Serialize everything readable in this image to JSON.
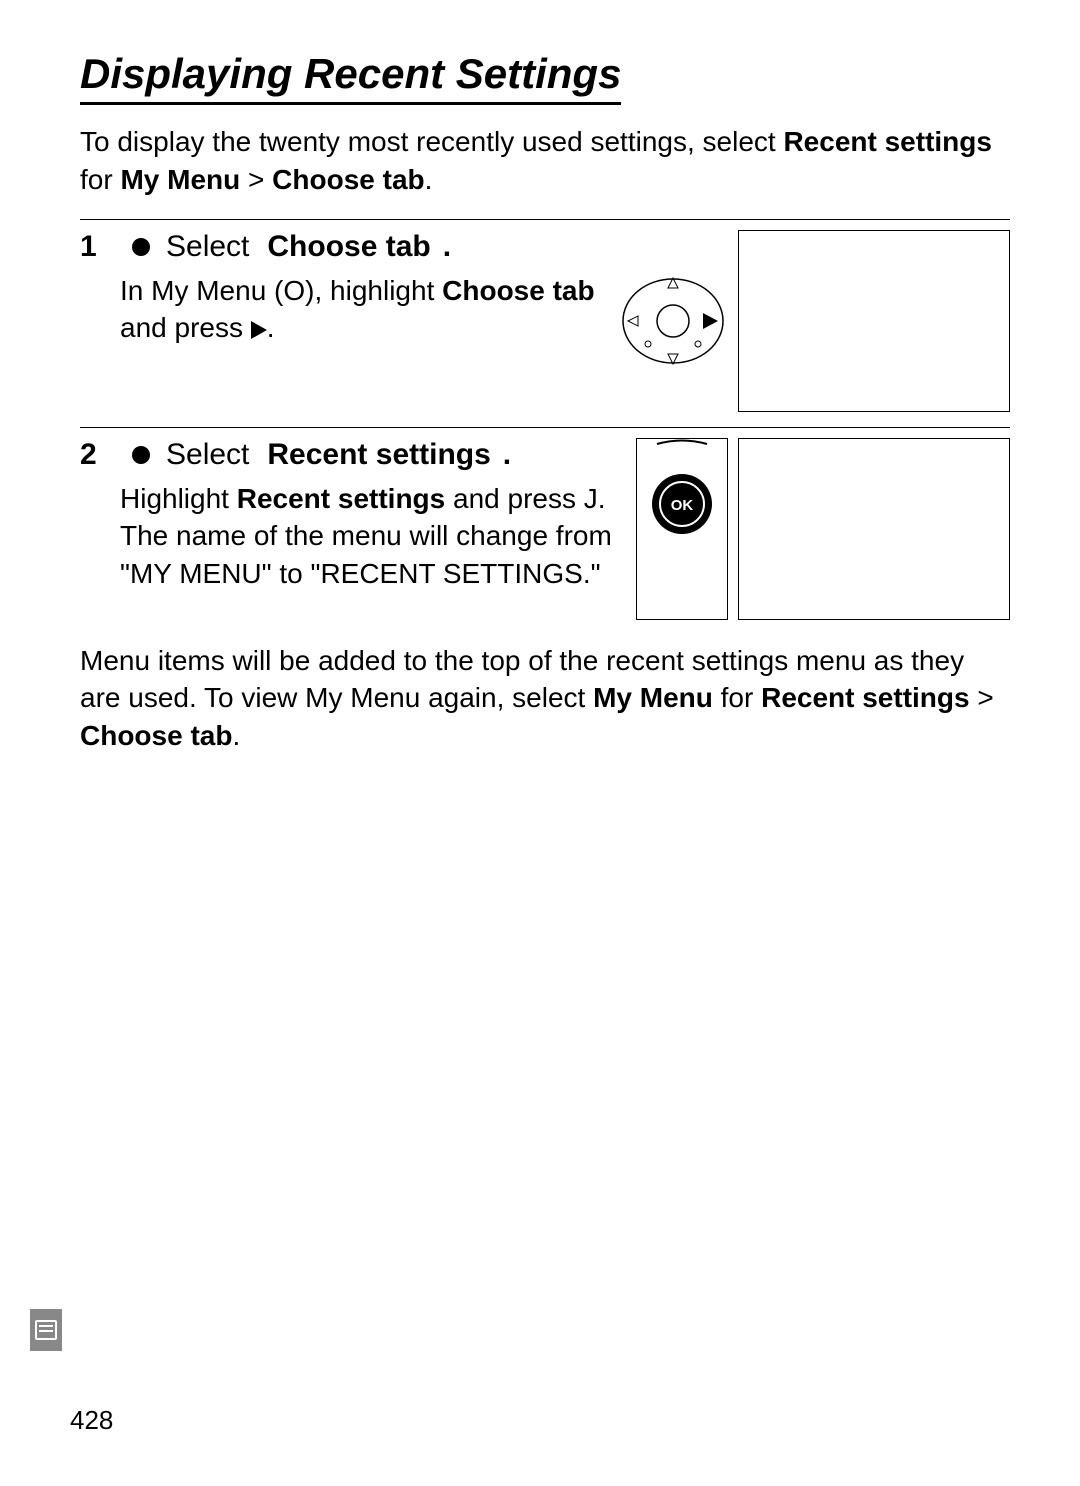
{
  "title": "Displaying Recent Settings",
  "intro": {
    "lead": "To display the twenty most recently used settings, select ",
    "bold1": "Recent settings",
    "mid": " for ",
    "bold2": "My Menu",
    "gt": " > ",
    "bold3": "Choose tab",
    "period": "."
  },
  "step1": {
    "num": "1",
    "select": "Select",
    "title": "Choose tab",
    "title_period": ".",
    "body_a": "In My Menu (",
    "body_icon": "O",
    "body_b": "), highlight ",
    "body_bold": "Choose tab",
    "body_c": " and press ",
    "body_d": "."
  },
  "step2": {
    "num": "2",
    "select": "Select",
    "title": "Recent settings",
    "title_period": ".",
    "body_a": "Highlight ",
    "body_bold1": "Recent settings",
    "body_b": " and press ",
    "body_ok": "J",
    "body_c": ".  The name of the menu will change from \"MY MENU\" to \"RECENT SETTINGS.\""
  },
  "outro": {
    "a": "Menu items will be added to the top of the recent settings menu as they are used.  To view My Menu again, select ",
    "bold1": "My Menu",
    "b": " for ",
    "bold2": "Recent settings",
    "gt": " > ",
    "bold3": "Choose tab",
    "period": "."
  },
  "page_num": "428"
}
